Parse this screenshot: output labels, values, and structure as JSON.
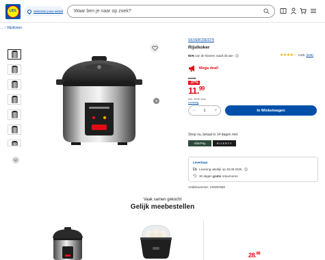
{
  "header": {
    "logo_text": "LIDL",
    "store_label": "Selecteer jouw winkel",
    "search_placeholder": "Waar ben je naar op zoek?"
  },
  "breadcrumb": {
    "prefix": "...",
    "current": "Rijstkoker"
  },
  "product": {
    "brand": "SILVERCREST®",
    "title": "Rijstkoker",
    "recommend_pct": "91%",
    "recommend_text": "van de klanten raadt dit aan",
    "rating_score": "4.5/5",
    "rating_count": "(528)",
    "rating_value": 4.5,
    "deal_label": "Mega deal!",
    "old_price": "34.99",
    "discount": "-37%",
    "price_main": "11.",
    "price_cents": "99",
    "vat_text": "Incl. BTW excl.",
    "vat_link": "Levering",
    "quantity": "1",
    "cart_button": "In Winkelwagen",
    "shopnow_text": "Shop nu, betaal in 14 dagen met",
    "pay_option_1": "AfterPay",
    "pay_option_2": "RIVERTY",
    "delivery_label": "Leverbaar",
    "delivery_line": "Levering uiterlijk op 29.09.2026",
    "return_prefix": "30 dagen",
    "return_bold": "gratis",
    "return_suffix": "retourneren",
    "article_number": "Artikelnummer: 100397680"
  },
  "bottom": {
    "subtitle": "Vaak samen gekocht",
    "title": "Gelijk meebestellen",
    "price_main": "28.",
    "price_cents": "98"
  },
  "colors": {
    "brand_blue": "#0050aa",
    "deal_red": "#e60a14",
    "star_yellow": "#f2a900"
  }
}
